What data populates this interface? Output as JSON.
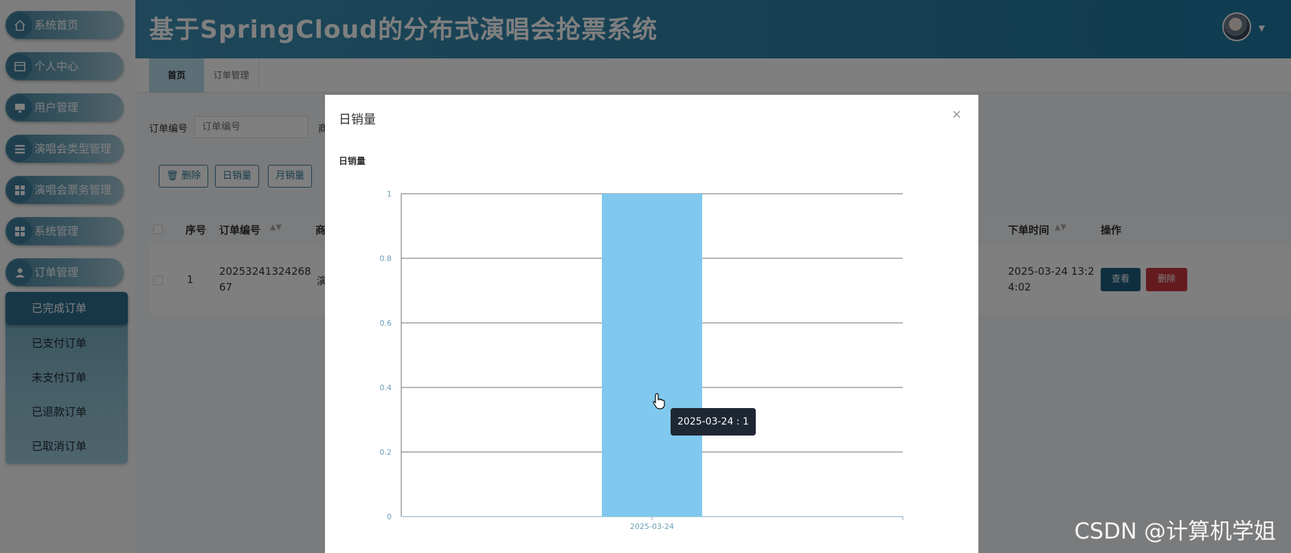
{
  "app": {
    "title": "基于SpringCloud的分布式演唱会抢票系统"
  },
  "sidebar": {
    "items": [
      {
        "label": "系统首页",
        "icon": "home-icon"
      },
      {
        "label": "个人中心",
        "icon": "id-card-icon"
      },
      {
        "label": "用户管理",
        "icon": "monitor-icon"
      },
      {
        "label": "演唱会类型管理",
        "icon": "list-icon"
      },
      {
        "label": "演唱会票务管理",
        "icon": "grid-icon"
      },
      {
        "label": "系统管理",
        "icon": "grid-icon"
      },
      {
        "label": "订单管理",
        "icon": "user-icon"
      }
    ],
    "submenu": [
      {
        "label": "已完成订单",
        "active": true
      },
      {
        "label": "已支付订单",
        "active": false
      },
      {
        "label": "未支付订单",
        "active": false
      },
      {
        "label": "已退款订单",
        "active": false
      },
      {
        "label": "已取消订单",
        "active": false
      }
    ]
  },
  "tabs": {
    "home": "首页",
    "orders": "订单管理"
  },
  "search": {
    "label": "订单编号",
    "placeholder": "订单编号",
    "extra_label": "商"
  },
  "toolbar": {
    "delete_label": "删除",
    "daily_sales_label": "日销量",
    "monthly_sales_label": "月销量"
  },
  "table": {
    "headers": {
      "index": "序号",
      "order_no": "订单编号",
      "col3": "商",
      "order_time": "下单时间",
      "actions": "操作"
    },
    "rows": [
      {
        "index": "1",
        "order_no_line1": "20253241324268",
        "order_no_line2": "67",
        "col3": "演",
        "time_line1": "2025-03-24 13:2",
        "time_line2": "4:02",
        "view_label": "查看",
        "delete_label": "删除"
      }
    ]
  },
  "modal": {
    "title": "日销量",
    "close": "×"
  },
  "chart_data": {
    "type": "bar",
    "title": "日销量",
    "categories": [
      "2025-03-24"
    ],
    "values": [
      1
    ],
    "ylim": [
      0,
      1
    ],
    "yticks": [
      0,
      0.2,
      0.4,
      0.6,
      0.8,
      1
    ],
    "grid": true,
    "bar_color": "#80c8ed",
    "tooltip": "2025-03-24 : 1"
  },
  "colors": {
    "header": "#2a7ea5",
    "accent": "#2e7a9c",
    "danger": "#c8363d",
    "view_button": "#1f5f80"
  },
  "watermark": "CSDN @计算机学姐"
}
